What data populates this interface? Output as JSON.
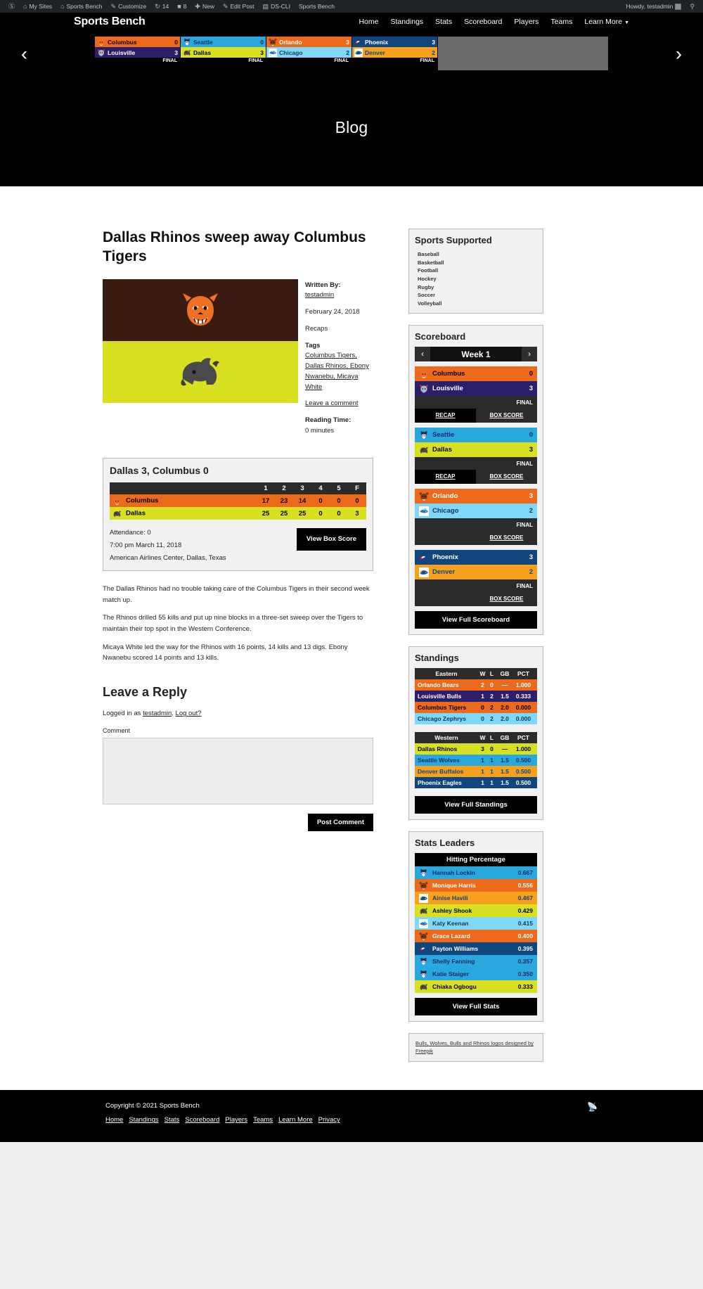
{
  "adminbar": {
    "left_items": [
      {
        "icon": "wordpress-icon",
        "glyph": "Ⓦ",
        "label": ""
      },
      {
        "icon": "my-sites-icon",
        "glyph": "⌂",
        "label": "My Sites"
      },
      {
        "icon": "site-icon",
        "glyph": "⌂",
        "label": "Sports Bench"
      },
      {
        "icon": "customize-icon",
        "glyph": "✎",
        "label": "Customize"
      },
      {
        "icon": "updates-icon",
        "glyph": "↻",
        "label": "14"
      },
      {
        "icon": "comments-icon",
        "glyph": "▣",
        "label": "8"
      },
      {
        "icon": "new-icon",
        "glyph": "✚",
        "label": "New"
      },
      {
        "icon": "edit-post-icon",
        "glyph": "✎",
        "label": "Edit Post"
      },
      {
        "icon": "ds-cli-icon",
        "glyph": "▤",
        "label": "DS-CLI"
      },
      {
        "icon": "",
        "glyph": "",
        "label": "Sports Bench"
      }
    ],
    "howdy": "Howdy, testadmin",
    "search_icon": "search-icon"
  },
  "header": {
    "brand": "Sports Bench",
    "nav": [
      "Home",
      "Standings",
      "Stats",
      "Scoreboard",
      "Players",
      "Teams"
    ],
    "nav_dropdown": "Learn More"
  },
  "carousel": {
    "prev_icon": "chevron-left-icon",
    "next_icon": "chevron-right-icon",
    "games": [
      {
        "status": "FINAL",
        "away": {
          "name": "Columbus",
          "score": "0",
          "bg": "#ed6a1c",
          "fg": "#000000",
          "logo": "tiger"
        },
        "home": {
          "name": "Louisville",
          "score": "3",
          "bg": "#2b1f6b",
          "fg": "#ffffff",
          "logo": "bull"
        }
      },
      {
        "status": "FINAL",
        "away": {
          "name": "Seattle",
          "score": "0",
          "bg": "#29a8e0",
          "fg": "#1b2a5e",
          "logo": "wolf"
        },
        "home": {
          "name": "Dallas",
          "score": "3",
          "bg": "#d9e021",
          "fg": "#000000",
          "logo": "rhino"
        }
      },
      {
        "status": "FINAL",
        "away": {
          "name": "Orlando",
          "score": "3",
          "bg": "#ed6a1c",
          "fg": "#ffffff",
          "logo": "bear"
        },
        "home": {
          "name": "Chicago",
          "score": "2",
          "bg": "#7fd8f7",
          "fg": "#12355b",
          "logo": "zephyr"
        }
      },
      {
        "status": "FINAL",
        "away": {
          "name": "Phoenix",
          "score": "3",
          "bg": "#11457e",
          "fg": "#ffffff",
          "logo": "eagle"
        },
        "home": {
          "name": "Denver",
          "score": "2",
          "bg": "#f5a11e",
          "fg": "#11457e",
          "logo": "buffalo"
        }
      }
    ]
  },
  "banner": {
    "title": "Blog"
  },
  "post": {
    "title": "Dallas Rhinos sweep away Columbus Tigers",
    "meta": {
      "written_by_label": "Written By:",
      "author": "testadmin",
      "date": "February 24, 2018",
      "category": "Recaps",
      "tags_label": "Tags",
      "tags": "Columbus Tigers, Dallas Rhinos, Ebony Nwanebu, Micaya White",
      "comment_link": "Leave a comment",
      "reading_time_label": "Reading Time:",
      "reading_time": "0 minutes"
    },
    "paragraphs": [
      "The Dallas Rhinos had no trouble taking care of the Columbus Tigers in their second week match up.",
      "The Rhinos drilled 55 kills and put up nine blocks in a three-set sweep over the Tigers to maintain their top spot in the Western Conference.",
      "Micaya White led the way for the Rhinos with 16 points, 14 kills and 13 digs. Ebony Nwanebu scored 14 points and 13 kills."
    ]
  },
  "gamebox": {
    "title": "Dallas 3, Columbus 0",
    "columns": [
      "1",
      "2",
      "3",
      "4",
      "5",
      "F"
    ],
    "rows": [
      {
        "team": "Columbus",
        "logo": "tiger",
        "bg": "#ed6a1c",
        "fg": "#000000",
        "scores": [
          "17",
          "23",
          "14",
          "0",
          "0",
          "0"
        ]
      },
      {
        "team": "Dallas",
        "logo": "rhino",
        "bg": "#d9e021",
        "fg": "#000000",
        "scores": [
          "25",
          "25",
          "25",
          "0",
          "0",
          "3"
        ]
      }
    ],
    "attendance": "Attendance: 0",
    "datetime": "7:00 pm March 11, 2018",
    "venue": "American Airlines Center, Dallas, Texas",
    "button": "View Box Score"
  },
  "comments": {
    "heading": "Leave a Reply",
    "logged_in_prefix": "Logged in as",
    "username": "testadmin",
    "logout": "Log out?",
    "comment_label": "Comment",
    "textarea_value": "",
    "submit": "Post Comment"
  },
  "sidebar": {
    "sports_supported": {
      "title": "Sports Supported",
      "items": [
        "Baseball",
        "Basketball",
        "Football",
        "Hockey",
        "Rugby",
        "Soccer",
        "Volleyball"
      ]
    },
    "scoreboard": {
      "title": "Scoreboard",
      "week": "Week 1",
      "prev_icon": "chevron-left-icon",
      "next_icon": "chevron-right-icon",
      "games": [
        {
          "status": "FINAL",
          "recap": "RECAP",
          "boxscore": "BOX SCORE",
          "has_recap": true,
          "away": {
            "name": "Columbus",
            "score": "0",
            "bg": "#ed6a1c",
            "fg": "#000000",
            "logo": "tiger"
          },
          "home": {
            "name": "Louisville",
            "score": "3",
            "bg": "#2b1f6b",
            "fg": "#ffffff",
            "logo": "bull"
          }
        },
        {
          "status": "FINAL",
          "recap": "RECAP",
          "boxscore": "BOX SCORE",
          "has_recap": true,
          "away": {
            "name": "Seattle",
            "score": "0",
            "bg": "#29a8e0",
            "fg": "#1b2a5e",
            "logo": "wolf"
          },
          "home": {
            "name": "Dallas",
            "score": "3",
            "bg": "#d9e021",
            "fg": "#000000",
            "logo": "rhino"
          }
        },
        {
          "status": "FINAL",
          "recap": "",
          "boxscore": "BOX SCORE",
          "has_recap": false,
          "away": {
            "name": "Orlando",
            "score": "3",
            "bg": "#ed6a1c",
            "fg": "#ffffff",
            "logo": "bear"
          },
          "home": {
            "name": "Chicago",
            "score": "2",
            "bg": "#7fd8f7",
            "fg": "#12355b",
            "logo": "zephyr"
          }
        },
        {
          "status": "FINAL",
          "recap": "",
          "boxscore": "BOX SCORE",
          "has_recap": false,
          "away": {
            "name": "Phoenix",
            "score": "3",
            "bg": "#11457e",
            "fg": "#ffffff",
            "logo": "eagle"
          },
          "home": {
            "name": "Denver",
            "score": "2",
            "bg": "#f5a11e",
            "fg": "#11457e",
            "logo": "buffalo"
          }
        }
      ],
      "full_button": "View Full Scoreboard"
    },
    "standings": {
      "title": "Standings",
      "columns": [
        "W",
        "L",
        "GB",
        "PCT"
      ],
      "tables": [
        {
          "conference": "Eastern",
          "rows": [
            {
              "team": "Orlando Bears",
              "w": "2",
              "l": "0",
              "gb": "—",
              "pct": "1.000",
              "bg": "#ed6a1c",
              "fg": "#ffffff"
            },
            {
              "team": "Louisville Bulls",
              "w": "1",
              "l": "2",
              "gb": "1.5",
              "pct": "0.333",
              "bg": "#2b1f6b",
              "fg": "#ffffff"
            },
            {
              "team": "Columbus Tigers",
              "w": "0",
              "l": "2",
              "gb": "2.0",
              "pct": "0.000",
              "bg": "#ed6a1c",
              "fg": "#000000"
            },
            {
              "team": "Chicago Zephrys",
              "w": "0",
              "l": "2",
              "gb": "2.0",
              "pct": "0.000",
              "bg": "#7fd8f7",
              "fg": "#12355b"
            }
          ]
        },
        {
          "conference": "Western",
          "rows": [
            {
              "team": "Dallas Rhinos",
              "w": "3",
              "l": "0",
              "gb": "—",
              "pct": "1.000",
              "bg": "#d9e021",
              "fg": "#000000"
            },
            {
              "team": "Seattle Wolves",
              "w": "1",
              "l": "1",
              "gb": "1.5",
              "pct": "0.500",
              "bg": "#29a8e0",
              "fg": "#1b2a5e"
            },
            {
              "team": "Denver Buffalos",
              "w": "1",
              "l": "1",
              "gb": "1.5",
              "pct": "0.500",
              "bg": "#f5a11e",
              "fg": "#11457e"
            },
            {
              "team": "Phoenix Eagles",
              "w": "1",
              "l": "1",
              "gb": "1.5",
              "pct": "0.500",
              "bg": "#11457e",
              "fg": "#ffffff"
            }
          ]
        }
      ],
      "full_button": "View Full Standings"
    },
    "stats_leaders": {
      "title": "Stats Leaders",
      "stat_name": "Hitting Percentage",
      "rows": [
        {
          "player": "Hannah Lockin",
          "value": "0.667",
          "logo": "wolf",
          "bg": "#29a8e0",
          "fg": "#1b2a5e"
        },
        {
          "player": "Monique Harris",
          "value": "0.556",
          "logo": "bear",
          "bg": "#ed6a1c",
          "fg": "#ffffff"
        },
        {
          "player": "Ainise Havili",
          "value": "0.467",
          "logo": "buffalo",
          "bg": "#f5a11e",
          "fg": "#11457e"
        },
        {
          "player": "Ashley Shook",
          "value": "0.429",
          "logo": "rhino",
          "bg": "#d9e021",
          "fg": "#000000"
        },
        {
          "player": "Katy Keenan",
          "value": "0.415",
          "logo": "zephyr",
          "bg": "#7fd8f7",
          "fg": "#12355b"
        },
        {
          "player": "Grace Lazard",
          "value": "0.400",
          "logo": "bear",
          "bg": "#ed6a1c",
          "fg": "#ffffff"
        },
        {
          "player": "Payton Williams",
          "value": "0.395",
          "logo": "eagle",
          "bg": "#11457e",
          "fg": "#ffffff"
        },
        {
          "player": "Shelly Fanning",
          "value": "0.357",
          "logo": "wolf",
          "bg": "#29a8e0",
          "fg": "#1b2a5e"
        },
        {
          "player": "Katie Staiger",
          "value": "0.350",
          "logo": "wolf",
          "bg": "#29a8e0",
          "fg": "#1b2a5e"
        },
        {
          "player": "Chiaka Ogbogu",
          "value": "0.333",
          "logo": "rhino",
          "bg": "#d9e021",
          "fg": "#000000"
        }
      ],
      "full_button": "View Full Stats"
    },
    "credit": "Bulls, Wolves, Bulls and Rhinos logos designed by Freepik"
  },
  "footer": {
    "copyright": "Copyright © 2021 Sports Bench",
    "nav": [
      "Home",
      "Standings",
      "Stats",
      "Scoreboard",
      "Players",
      "Teams",
      "Learn More",
      "Privacy"
    ],
    "rss_icon": "rss-icon"
  }
}
